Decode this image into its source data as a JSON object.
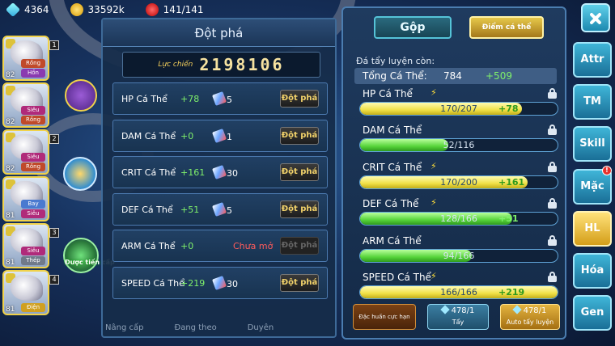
{
  "topbar": {
    "diamonds": "4364",
    "coins": "33592k",
    "stamina": "141/141"
  },
  "team": [
    {
      "level": "82",
      "tag1": "Rồng",
      "tag2": "Hồn",
      "slot": "1",
      "tag1_color": "#c04a2a",
      "tag2_color": "#8a3ab0"
    },
    {
      "level": "82",
      "tag1": "Siêu",
      "tag2": "Rồng",
      "slot": "",
      "tag1_color": "#b02a7a",
      "tag2_color": "#c04a2a"
    },
    {
      "level": "82",
      "tag1": "Siêu",
      "tag2": "Rồng",
      "slot": "2",
      "tag1_color": "#b02a7a",
      "tag2_color": "#c04a2a"
    },
    {
      "level": "81",
      "tag1": "Bay",
      "tag2": "Siêu",
      "slot": "",
      "tag1_color": "#4a7ad0",
      "tag2_color": "#b02a7a"
    },
    {
      "level": "81",
      "tag1": "Siêu",
      "tag2": "Thép",
      "slot": "3",
      "tag1_color": "#b02a7a",
      "tag2_color": "#707a8a"
    },
    {
      "level": "81",
      "tag1": "",
      "tag2": "Điện",
      "slot": "4",
      "tag1_color": "#555555",
      "tag2_color": "#d0a020"
    }
  ],
  "evolve_label": "Được tiến cấp",
  "breakthrough": {
    "title": "Đột phá",
    "power_label": "Lực chiến",
    "power_value": "2198106",
    "stats": [
      {
        "name": "HP Cá Thể",
        "bonus": "+78",
        "cost": "5",
        "status": "",
        "button": "Đột phá",
        "enabled": true
      },
      {
        "name": "DAM Cá Thể",
        "bonus": "+0",
        "cost": "1",
        "status": "",
        "button": "Đột phá",
        "enabled": true
      },
      {
        "name": "CRIT Cá Thể",
        "bonus": "+161",
        "cost": "30",
        "status": "",
        "button": "Đột phá",
        "enabled": true
      },
      {
        "name": "DEF Cá Thể",
        "bonus": "+51",
        "cost": "5",
        "status": "",
        "button": "Đột phá",
        "enabled": true
      },
      {
        "name": "ARM Cá Thể",
        "bonus": "+0",
        "cost": "",
        "status": "Chưa mở",
        "button": "Đột phá",
        "enabled": false
      },
      {
        "name": "SPEED Cá Thể",
        "bonus": "+219",
        "cost": "30",
        "status": "",
        "button": "Đột phá",
        "enabled": true
      }
    ],
    "bottom_tabs": [
      "Nâng cấp",
      "Đang theo",
      "Duyên"
    ]
  },
  "training": {
    "merge_button": "Gộp",
    "individual_button": "Điểm cá thể",
    "remaining_label": "Đá tẩy luyện còn:",
    "total_label": "Tổng Cá Thể:",
    "total_value": "784",
    "total_bonus": "+509",
    "stats": [
      {
        "name": "HP Cá Thể",
        "current": 170,
        "max": 207,
        "value": "170/207",
        "add": "+78",
        "color": "yellow",
        "bolt": true
      },
      {
        "name": "DAM Cá Thể",
        "current": 52,
        "max": 116,
        "value": "52/116",
        "add": "",
        "color": "green",
        "bolt": false
      },
      {
        "name": "CRIT Cá Thể",
        "current": 170,
        "max": 200,
        "value": "170/200",
        "add": "+161",
        "color": "yellow",
        "bolt": true
      },
      {
        "name": "DEF Cá Thể",
        "current": 128,
        "max": 166,
        "value": "128/166",
        "add": "+51",
        "color": "green",
        "bolt": true
      },
      {
        "name": "ARM Cá Thể",
        "current": 94,
        "max": 166,
        "value": "94/166",
        "add": "",
        "color": "green",
        "bolt": false
      },
      {
        "name": "SPEED Cá Thể",
        "current": 166,
        "max": 166,
        "value": "166/166",
        "add": "+219",
        "color": "yellow",
        "bolt": true
      }
    ],
    "actions": {
      "special": "Đặc huấn cực hạn",
      "wash_count": "478/1",
      "wash_label": "Tẩy",
      "auto_count": "478/1",
      "auto_label": "Auto tẩy luyện"
    }
  },
  "side_tabs": [
    {
      "label": "Attr",
      "active": false,
      "alert": false
    },
    {
      "label": "TM",
      "active": false,
      "alert": false
    },
    {
      "label": "Skill",
      "active": false,
      "alert": false
    },
    {
      "label": "Mặc",
      "active": false,
      "alert": true
    },
    {
      "label": "HL",
      "active": true,
      "alert": false
    },
    {
      "label": "Hóa",
      "active": false,
      "alert": false
    },
    {
      "label": "Gen",
      "active": false,
      "alert": false
    }
  ],
  "alert_mark": "!",
  "colors": {
    "bonus_green": "#7ff06b",
    "locked_red": "#ff5b5b",
    "gold": "#f2d26a"
  }
}
